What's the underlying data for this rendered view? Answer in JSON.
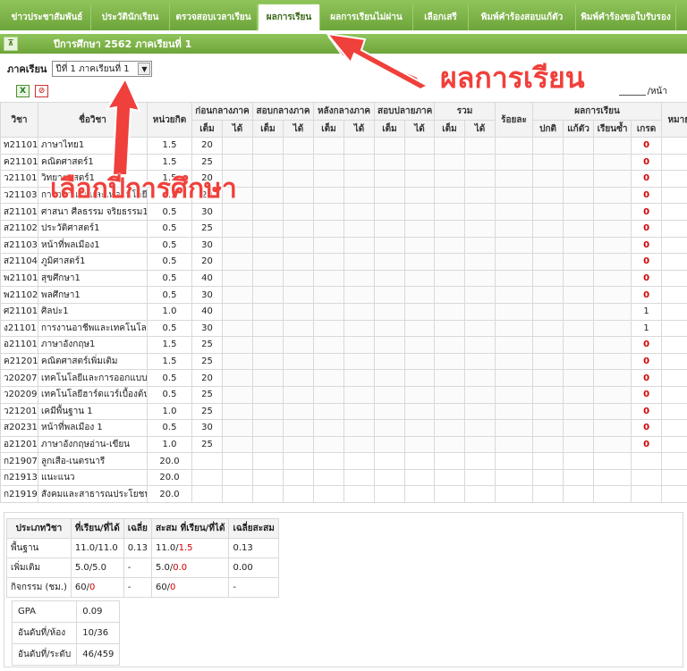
{
  "nav": [
    {
      "label": "ข่าวประชาสัมพันธ์",
      "active": false
    },
    {
      "label": "ประวัตินักเรียน",
      "active": false
    },
    {
      "label": "ตรวจสอบเวลาเรียน",
      "active": false
    },
    {
      "label": "ผลการเรียน",
      "active": true
    },
    {
      "label": "ผลการเรียนไม่ผ่าน",
      "active": false
    },
    {
      "label": "เลือกเสรี",
      "active": false
    },
    {
      "label": "พิมพ์คำร้องสอบแก้ตัว",
      "active": false
    },
    {
      "label": "พิมพ์คำร้องขอใบรับรอง",
      "active": false
    }
  ],
  "section": {
    "collapse_icon": "collapse-icon",
    "title": "ปีการศึกษา 2562 ภาคเรียนที่ 1"
  },
  "term": {
    "label": "ภาคเรียน",
    "selected": "ปีที่ 1 ภาคเรียนที่ 1",
    "arrow": "▼"
  },
  "toolbar": {
    "excel_icon": "X",
    "clear_icon": "⊘",
    "per_page": "/หน้า"
  },
  "table": {
    "headers": {
      "subject_code": "วิชา",
      "subject_name": "ชื่อวิชา",
      "credit": "หน่วยกิต",
      "pre_mid": "ก่อนกลางภาค",
      "midterm": "สอบกลางภาค",
      "post_mid": "หลังกลางภาค",
      "final": "สอบปลายภาค",
      "total": "รวม",
      "percent": "ร้อยละ",
      "result": "ผลการเรียน",
      "remark": "หมายเหตุ",
      "full": "เต็ม",
      "got": "ได้",
      "normal": "ปกติ",
      "fixed": "แก้ตัว",
      "repeat": "เรียนซ้ำ",
      "grade": "เกรด"
    },
    "rows": [
      {
        "code": "ท21101",
        "name": "ภาษาไทย1",
        "credit": "1.5",
        "pre_full": "20",
        "grade": "0"
      },
      {
        "code": "ค21101",
        "name": "คณิตศาสตร์1",
        "credit": "1.5",
        "pre_full": "25",
        "grade": "0"
      },
      {
        "code": "ว21101",
        "name": "วิทยาศาสตร์1",
        "credit": "1.5",
        "pre_full": "20",
        "grade": "0"
      },
      {
        "code": "ว21103",
        "name": "การออกแบบและเทคโนโลยี1",
        "credit": "0.5",
        "pre_full": "20",
        "grade": "0"
      },
      {
        "code": "ส21101",
        "name": "ศาสนา ศีลธรรม จริยธรรม1",
        "credit": "0.5",
        "pre_full": "30",
        "grade": "0"
      },
      {
        "code": "ส21102",
        "name": "ประวัติศาสตร์1",
        "credit": "0.5",
        "pre_full": "25",
        "grade": "0"
      },
      {
        "code": "ส21103",
        "name": "หน้าที่พลเมือง1",
        "credit": "0.5",
        "pre_full": "30",
        "grade": "0"
      },
      {
        "code": "ส21104",
        "name": "ภูมิศาสตร์1",
        "credit": "0.5",
        "pre_full": "20",
        "grade": "0"
      },
      {
        "code": "พ21101",
        "name": "สุขศึกษา1",
        "credit": "0.5",
        "pre_full": "40",
        "grade": "0"
      },
      {
        "code": "พ21102",
        "name": "พลศึกษา1",
        "credit": "0.5",
        "pre_full": "30",
        "grade": "0"
      },
      {
        "code": "ศ21101",
        "name": "ศิลปะ1",
        "credit": "1.0",
        "pre_full": "40",
        "grade": "1"
      },
      {
        "code": "ง21101",
        "name": "การงานอาชีพและเทคโนโลยี1",
        "credit": "0.5",
        "pre_full": "30",
        "grade": "1"
      },
      {
        "code": "อ21101",
        "name": "ภาษาอังกฤษ1",
        "credit": "1.5",
        "pre_full": "25",
        "grade": "0"
      },
      {
        "code": "ค21201",
        "name": "คณิตศาสตร์เพิ่มเติม",
        "credit": "1.5",
        "pre_full": "25",
        "grade": "0"
      },
      {
        "code": "ว20207",
        "name": "เทคโนโลยีและการออกแบบ",
        "credit": "0.5",
        "pre_full": "20",
        "grade": "0"
      },
      {
        "code": "ว20209",
        "name": "เทคโนโลยีฮาร์ดแวร์เบื้องต้น",
        "credit": "0.5",
        "pre_full": "25",
        "grade": "0"
      },
      {
        "code": "ว21201",
        "name": "เคมีพื้นฐาน 1",
        "credit": "1.0",
        "pre_full": "25",
        "grade": "0"
      },
      {
        "code": "ส20231",
        "name": "หน้าที่พลเมือง 1",
        "credit": "0.5",
        "pre_full": "30",
        "grade": "0"
      },
      {
        "code": "อ21201",
        "name": "ภาษาอังกฤษอ่าน-เขียน",
        "credit": "1.0",
        "pre_full": "25",
        "grade": "0"
      },
      {
        "code": "ก21907",
        "name": "ลูกเสือ-เนตรนารี",
        "credit": "20.0",
        "pre_full": "",
        "grade": ""
      },
      {
        "code": "ก21913",
        "name": "แนะแนว",
        "credit": "20.0",
        "pre_full": "",
        "grade": ""
      },
      {
        "code": "ก21919",
        "name": "สังคมและสาธารณประโยชน์",
        "credit": "20.0",
        "pre_full": "",
        "grade": ""
      }
    ]
  },
  "summary": {
    "headers": [
      "ประเภทวิชา",
      "ที่เรียน/ที่ได้",
      "เฉลี่ย",
      "สะสม ที่เรียน/ที่ได้",
      "เฉลี่ยสะสม"
    ],
    "rows": [
      {
        "type": "พื้นฐาน",
        "taken": "11.0/11.0",
        "avg": "0.13",
        "acc_a": "11.0/",
        "acc_b": "1.5",
        "acc_avg": "0.13"
      },
      {
        "type": "เพิ่มเติม",
        "taken": "5.0/5.0",
        "avg": "-",
        "acc_a": "5.0/",
        "acc_b": "0.0",
        "acc_avg": "0.00"
      },
      {
        "type": "กิจกรรม (ชม.)",
        "taken": "60/",
        "taken_b": "0",
        "avg": "-",
        "acc_a": "60/",
        "acc_b": "0",
        "acc_avg": "-"
      }
    ],
    "gpa_label": "GPA",
    "gpa": "0.09",
    "rank_room_label": "อันดับที่/ห้อง",
    "rank_room": "10/36",
    "rank_level_label": "อันดับที่/ระดับ",
    "rank_level": "46/459"
  },
  "annotations": {
    "grades_tab": "ผลการเรียน",
    "select_year": "เลือกปีการศึกษา",
    "color": "#f0403b"
  },
  "colors": {
    "nav_green": "#7db446",
    "grade_red": "#d00000"
  }
}
